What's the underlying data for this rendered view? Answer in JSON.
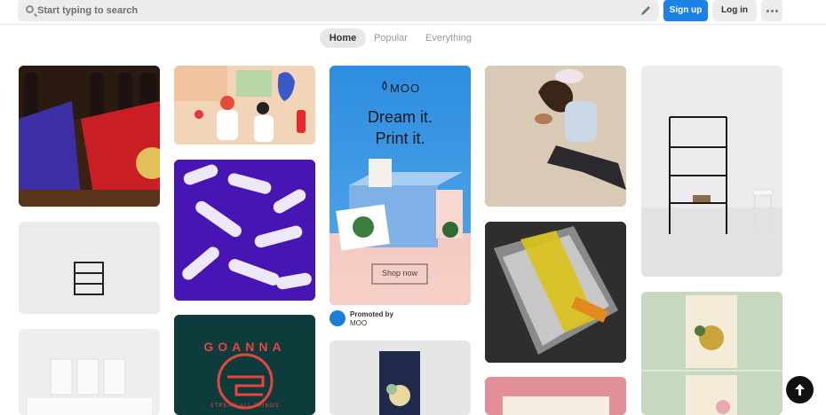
{
  "header": {
    "search_placeholder": "Start typing to search",
    "signup_label": "Sign up",
    "login_label": "Log in"
  },
  "tabs": [
    {
      "label": "Home",
      "active": true
    },
    {
      "label": "Popular",
      "active": false
    },
    {
      "label": "Everything",
      "active": false
    }
  ],
  "promo": {
    "brand": "MOO",
    "headline_1": "Dream it.",
    "headline_2": "Print it.",
    "cta": "Shop now",
    "promoted_by": "Promoted by",
    "advertiser": "MOO"
  },
  "pins": {
    "goanna_title": "GOANNA",
    "goanna_sub": "STREAM ALL THINGS"
  },
  "colors": {
    "signup_blue": "#1d82e8",
    "moo_blue": "#1d7ed6"
  }
}
